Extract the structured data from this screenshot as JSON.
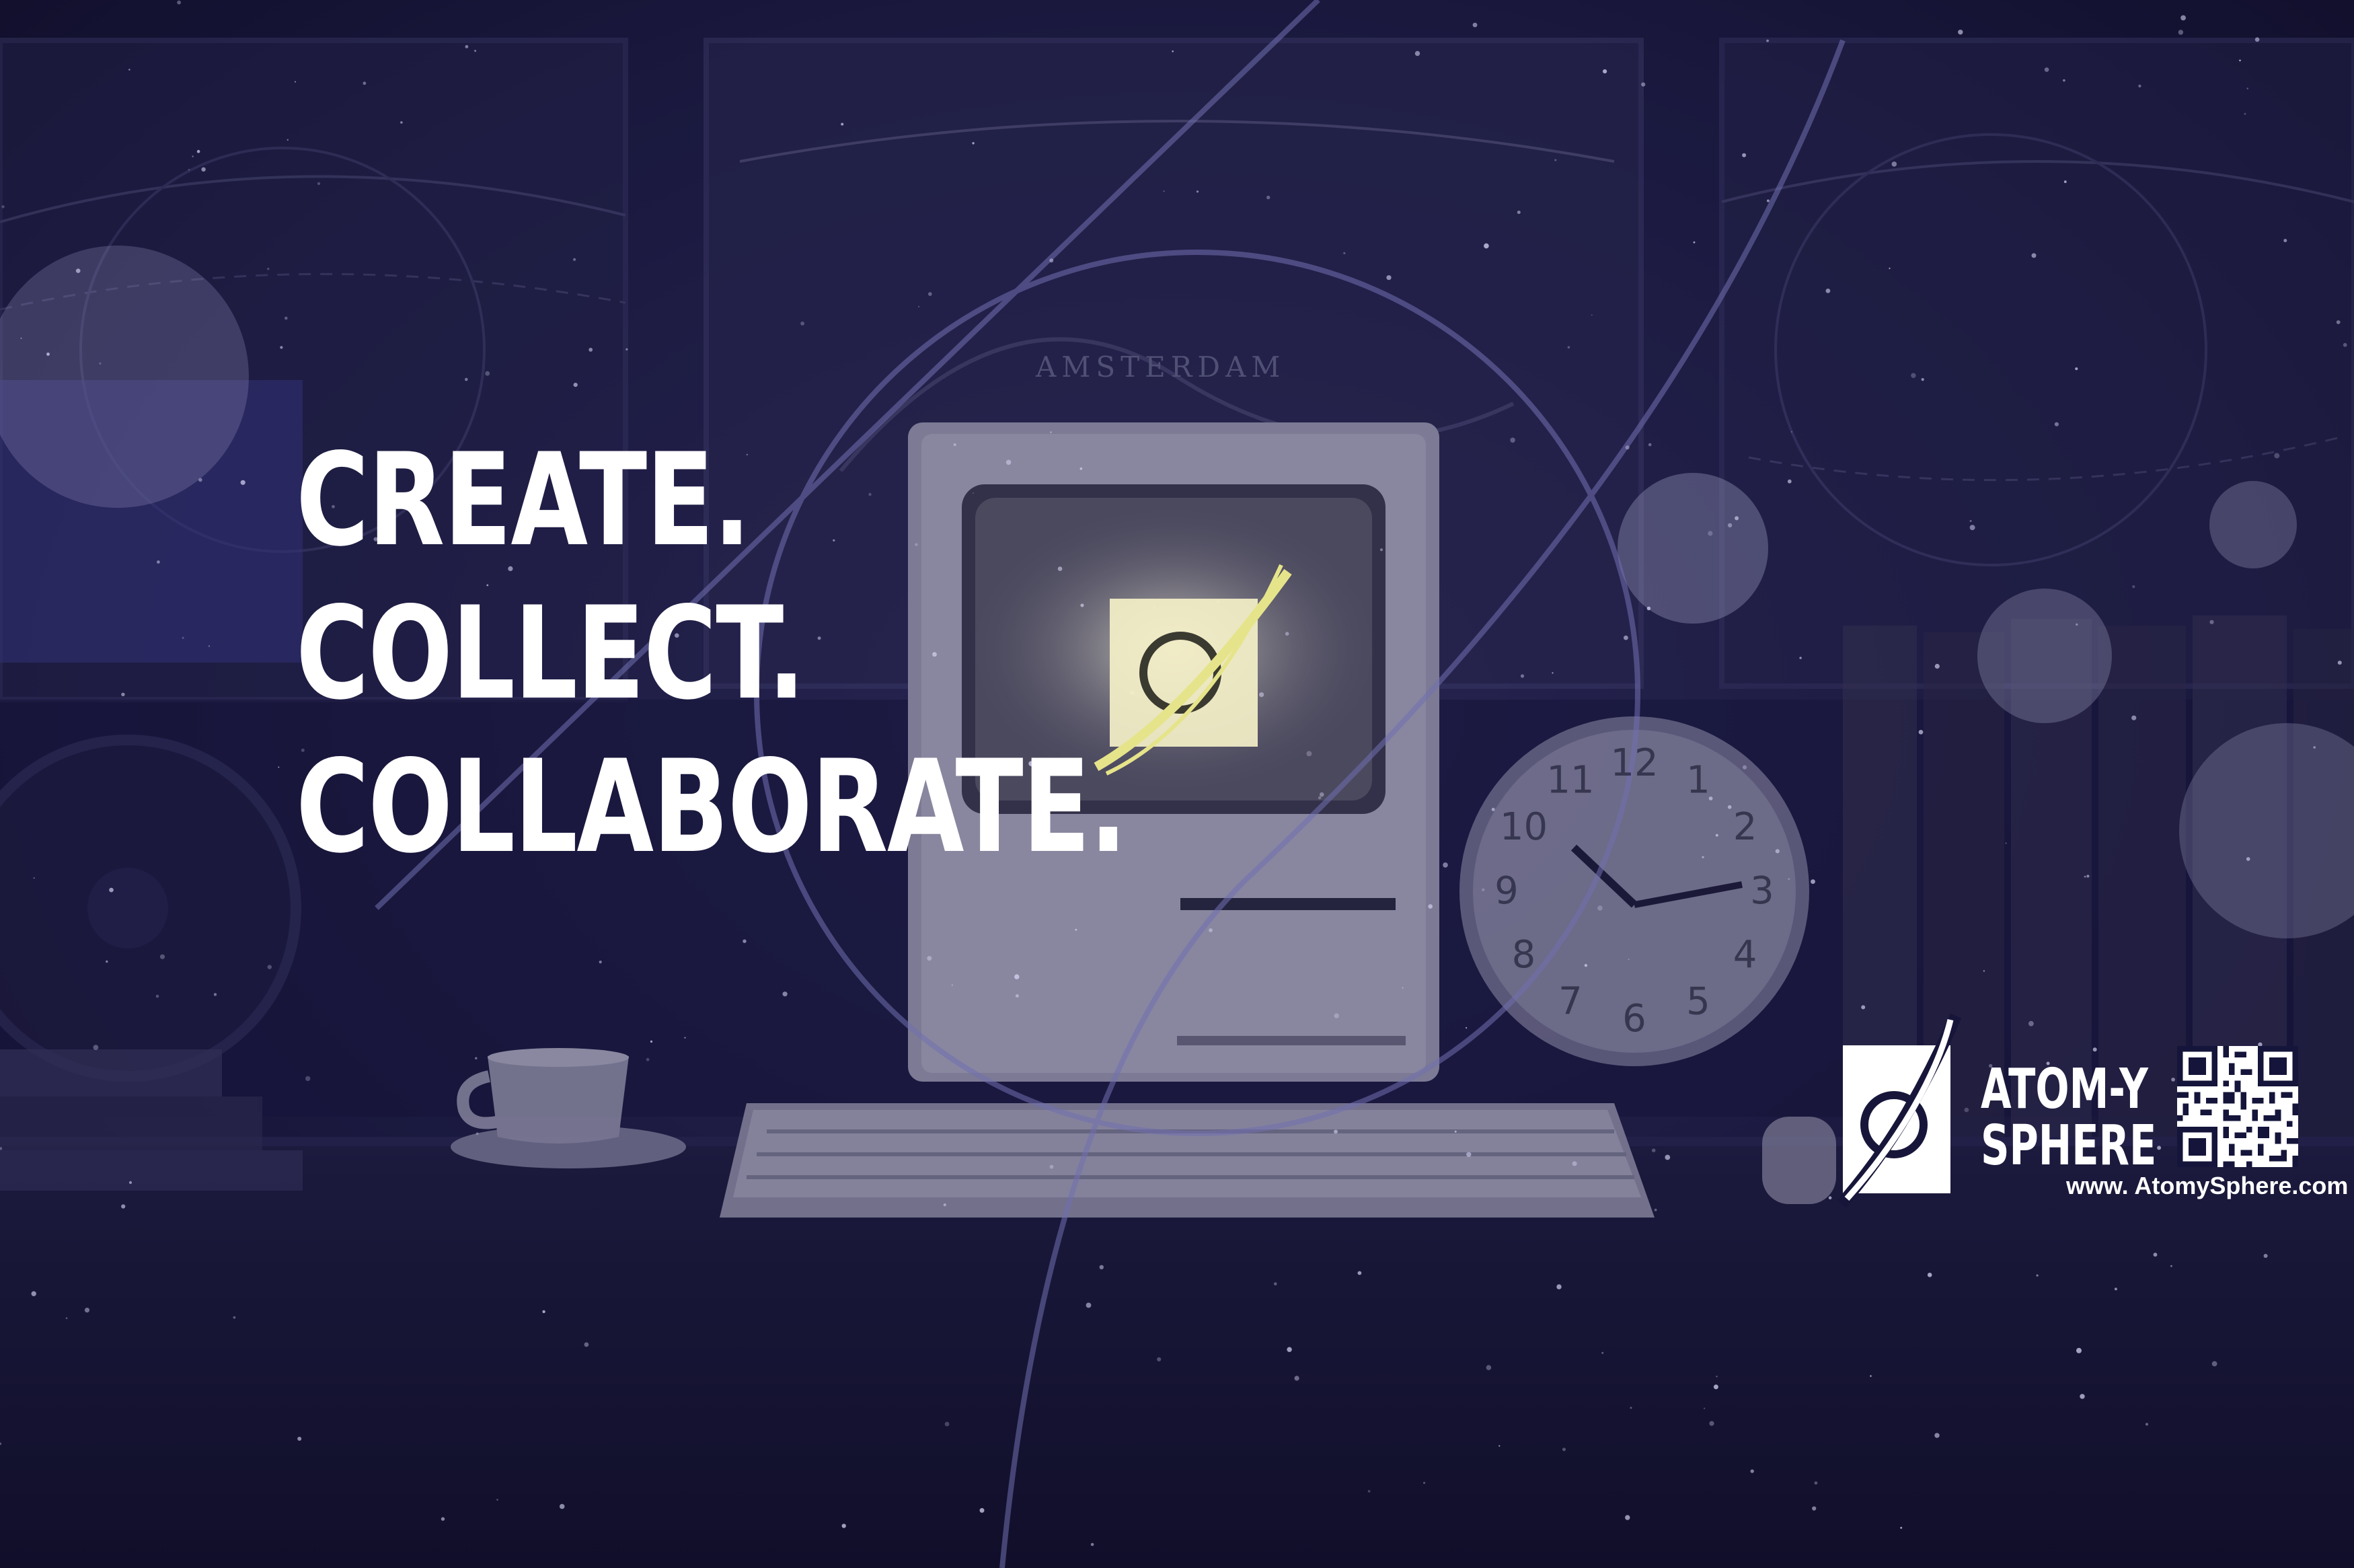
{
  "headline": {
    "line1": "CREATE.",
    "line2": "COLLECT.",
    "line3": "COLLABORATE."
  },
  "brand": {
    "name_line1": "ATOM-Y",
    "name_line2": "SPHERE",
    "website": "www. AtomySphere.com",
    "logo_icon": "planet-ring-icon",
    "qr_icon": "qr-code-icon"
  },
  "scene": {
    "wall_map_caption": "AMSTERDAM",
    "clock_numbers": [
      "12",
      "1",
      "2",
      "3",
      "4",
      "5",
      "6",
      "7",
      "8",
      "9",
      "10",
      "11"
    ]
  },
  "colors": {
    "background": "#14132d",
    "overlay_blue": "#2a2a6e",
    "text": "#ffffff",
    "screen_glow": "#f3f0c6"
  }
}
